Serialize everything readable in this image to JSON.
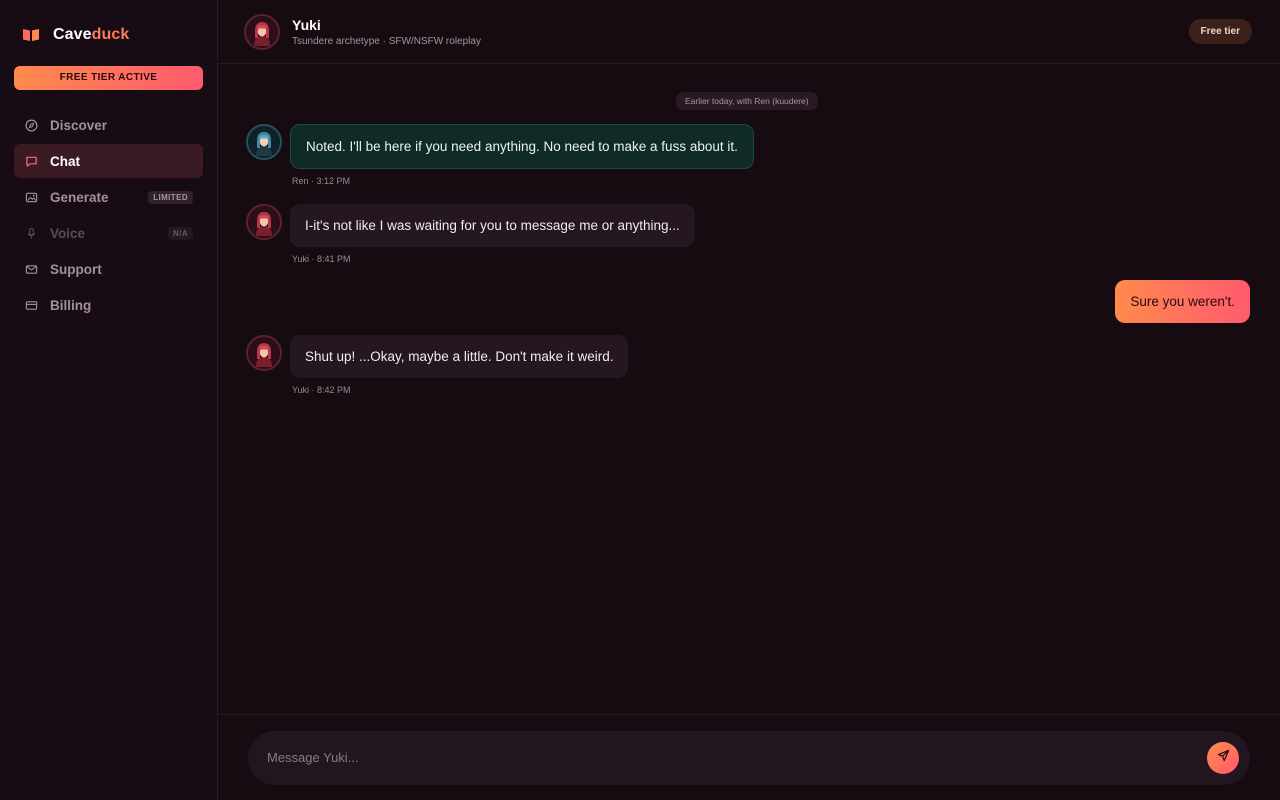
{
  "brand": {
    "name_part1": "Cave",
    "name_part2": "duck",
    "icon": "book-icon"
  },
  "tier_banner": "FREE TIER ACTIVE",
  "sidebar": {
    "items": [
      {
        "label": "Discover",
        "icon": "compass-icon",
        "badge": ""
      },
      {
        "label": "Chat",
        "icon": "chat-bubble-icon",
        "badge": "",
        "active": true
      },
      {
        "label": "Generate",
        "icon": "image-icon",
        "badge": "LIMITED"
      },
      {
        "label": "Voice",
        "icon": "microphone-icon",
        "badge": "N/A",
        "disabled": true
      },
      {
        "label": "Support",
        "icon": "mail-icon",
        "badge": ""
      },
      {
        "label": "Billing",
        "icon": "credit-card-icon",
        "badge": ""
      }
    ]
  },
  "header": {
    "name": "Yuki",
    "subtitle": "Tsundere archetype · SFW/NSFW roleplay",
    "tier_badge": "Free tier"
  },
  "chat": {
    "day_divider": "Earlier today, with Ren (kuudere)",
    "messages": [
      {
        "sender": "Ren",
        "text": "Noted. I'll be here if you need anything. No need to make a fuss about it.",
        "meta": "Ren · 3:12 PM"
      },
      {
        "sender": "Yuki",
        "text": "I-it's not like I was waiting for you to message me or anything...",
        "meta": "Yuki · 8:41 PM"
      },
      {
        "sender": "You",
        "text": "Sure you weren't."
      },
      {
        "sender": "Yuki",
        "text": "Shut up! ...Okay, maybe a little. Don't make it weird.",
        "meta": "Yuki · 8:42 PM"
      }
    ]
  },
  "composer": {
    "placeholder": "Message Yuki...",
    "value": ""
  },
  "colors": {
    "accent_start": "#ff8a4c",
    "accent_end": "#ff5a6e",
    "background": "#150b11"
  }
}
